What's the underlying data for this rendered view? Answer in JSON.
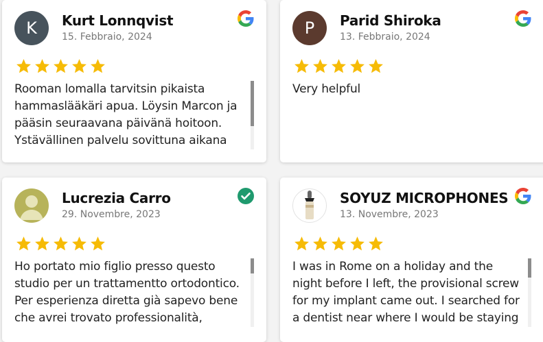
{
  "reviews": [
    {
      "name": "Kurt Lonnqvist",
      "date": "15. Febbraio, 2024",
      "avatar_letter": "K",
      "avatar_color": "#47535c",
      "rating": 5,
      "source_icon": "google-icon",
      "text": "Rooman lomalla tarvitsin pikaista hammaslääkäri apua. Löysin Marcon ja pääsin seuraavana päivänä hoitoon. Ystävällinen palvelu sovittuna aikana"
    },
    {
      "name": "Parid Shiroka",
      "date": "13. Febbraio, 2024",
      "avatar_letter": "P",
      "avatar_color": "#5b3a2e",
      "rating": 5,
      "source_icon": "google-icon",
      "text": "Very helpful"
    },
    {
      "name": "Lucrezia Carro",
      "date": "29. Novembre, 2023",
      "avatar_letter": "",
      "avatar_color": "#b7b35a",
      "rating": 5,
      "source_icon": "verified-check-icon",
      "text": "Ho portato mio figlio presso questo studio per un trattamentto ortodontico. Per esperienza diretta già sapevo bene che avrei trovato professionalità,"
    },
    {
      "name": "SOYUZ MICROPHONES",
      "date": "13. Novembre, 2023",
      "avatar_letter": "",
      "avatar_color": "#ffffff",
      "rating": 5,
      "source_icon": "google-icon",
      "text": "I was in Rome on a holiday and the night before I left, the provisional screw for my implant came out. I searched for a dentist near where I would be staying in"
    }
  ],
  "colors": {
    "star": "#f6bb06",
    "verified": "#1f9a6e",
    "text": "#222222",
    "date": "#777777"
  }
}
